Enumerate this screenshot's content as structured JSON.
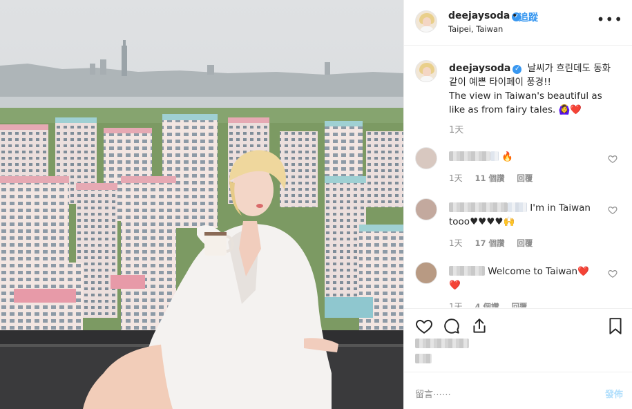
{
  "post": {
    "username": "deejaysoda",
    "verified_icon": "check-icon",
    "separator": "•",
    "follow_label": "追蹤",
    "location": "Taipei, Taiwan",
    "more_label": "•••"
  },
  "caption": {
    "username": "deejaysoda",
    "text_korean": "날씨가 흐린데도 동화 같이 예쁜 타이페이 풍경!!",
    "text_english": "The view in Taiwan's beautiful as like as from fairy tales.",
    "emojis": "🙆‍♀️❤️",
    "time": "1天"
  },
  "comments": [
    {
      "text": "🔥",
      "time": "1天",
      "likes": "11 個讚",
      "reply": "回覆"
    },
    {
      "text": "I'm in Taiwan tooo♥♥♥♥🙌",
      "time": "1天",
      "likes": "17 個讚",
      "reply": "回覆"
    },
    {
      "text": "Welcome to Taiwan❤️",
      "text2": "❤️",
      "time": "1天",
      "likes": "4 個讚",
      "reply": "回覆"
    }
  ],
  "comment_box": {
    "placeholder": "留言⋯⋯",
    "post_label": "發佈"
  },
  "colors": {
    "accent": "#3897f0",
    "heart": "#e0245e",
    "muted": "#8e8e8e"
  }
}
